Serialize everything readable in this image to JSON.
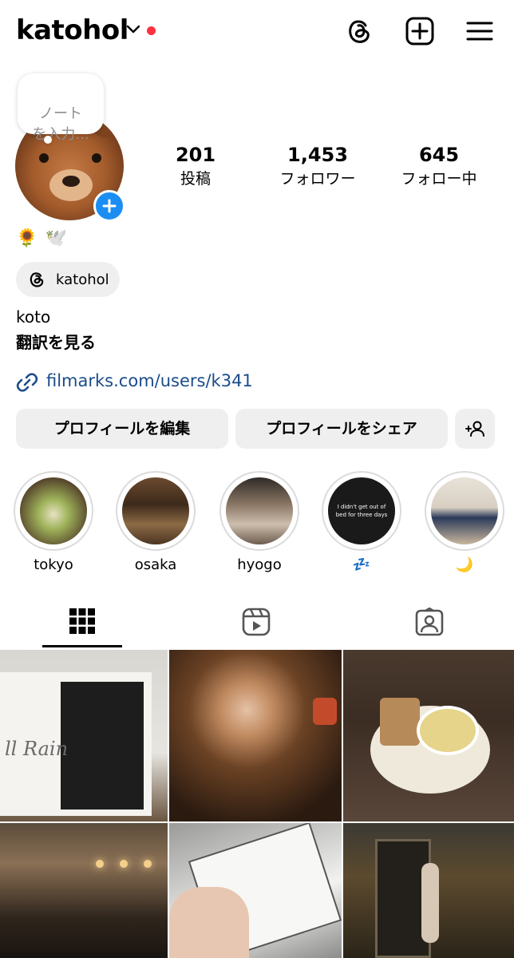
{
  "header": {
    "username": "katohol",
    "icons": [
      "chevron-down-icon",
      "threads-icon",
      "create-icon",
      "menu-icon"
    ],
    "notification_dot_color": "#ff3040"
  },
  "note": {
    "placeholder": "ノート\nを入力..."
  },
  "profile": {
    "emoji": [
      "🌻",
      "🕊️"
    ],
    "threads_handle": "katohol",
    "bio_name": "koto",
    "translate_label": "翻訳を見る",
    "link": "filmarks.com/users/k341"
  },
  "stats": [
    {
      "value": "201",
      "label": "投稿"
    },
    {
      "value": "1,453",
      "label": "フォロワー"
    },
    {
      "value": "645",
      "label": "フォロー中"
    }
  ],
  "buttons": {
    "edit_profile": "プロフィールを編集",
    "share_profile": "プロフィールをシェア"
  },
  "highlights": [
    {
      "label": "tokyo"
    },
    {
      "label": "osaka"
    },
    {
      "label": "hyogo"
    },
    {
      "label": "💤",
      "cover_text": "I didn't get out of bed for three days"
    },
    {
      "label": "🌙"
    }
  ],
  "tabs": [
    "grid-icon",
    "reels-icon",
    "tagged-icon"
  ],
  "posts": [
    {
      "overlay_text": "ll Rain"
    },
    {},
    {},
    {},
    {},
    {}
  ],
  "colors": {
    "link": "#1a4c8a",
    "accent_blue": "#1c8ef3",
    "button_bg": "#efefef"
  }
}
